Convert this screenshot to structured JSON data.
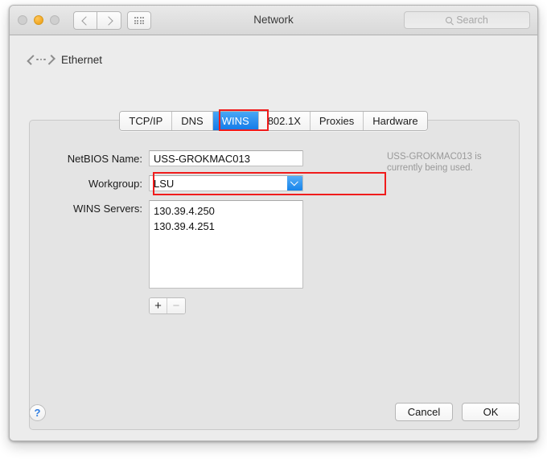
{
  "window": {
    "title": "Network",
    "traffic_lights": [
      "close",
      "minimize",
      "zoom"
    ],
    "nav_back": "back-chevron",
    "nav_forward": "forward-chevron",
    "grid_button": "show-all-icon",
    "search_placeholder": "Search"
  },
  "interface": {
    "icon": "ethernet-icon",
    "name": "Ethernet"
  },
  "tabs": [
    {
      "label": "TCP/IP",
      "active": false
    },
    {
      "label": "DNS",
      "active": false
    },
    {
      "label": "WINS",
      "active": true
    },
    {
      "label": "802.1X",
      "active": false
    },
    {
      "label": "Proxies",
      "active": false
    },
    {
      "label": "Hardware",
      "active": false
    }
  ],
  "form": {
    "netbios_label": "NetBIOS Name:",
    "netbios_value": "USS-GROKMAC013",
    "workgroup_label": "Workgroup:",
    "workgroup_value": "LSU",
    "wins_label": "WINS Servers:",
    "wins_servers": [
      "130.39.4.250",
      "130.39.4.251"
    ],
    "add_label": "+",
    "remove_label": "−",
    "hint_text": "USS-GROKMAC013 is currently being used."
  },
  "footer": {
    "help_label": "?",
    "cancel_label": "Cancel",
    "ok_label": "OK"
  },
  "annotations": {
    "highlight_color": "#f01c1c",
    "targets": [
      "wins-tab",
      "workgroup-row"
    ]
  },
  "colors": {
    "accent_blue": "#1784ea",
    "window_bg": "#ececec",
    "panel_bg": "#e4e4e4",
    "hint_gray": "#999999"
  }
}
